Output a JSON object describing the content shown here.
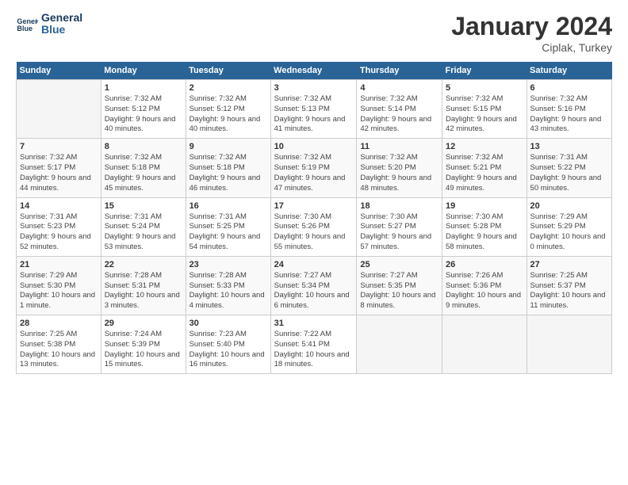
{
  "header": {
    "logo_line1": "General",
    "logo_line2": "Blue",
    "month_title": "January 2024",
    "subtitle": "Ciplak, Turkey"
  },
  "weekdays": [
    "Sunday",
    "Monday",
    "Tuesday",
    "Wednesday",
    "Thursday",
    "Friday",
    "Saturday"
  ],
  "weeks": [
    [
      {
        "day": "",
        "sunrise": "",
        "sunset": "",
        "daylight": ""
      },
      {
        "day": "1",
        "sunrise": "Sunrise: 7:32 AM",
        "sunset": "Sunset: 5:12 PM",
        "daylight": "Daylight: 9 hours and 40 minutes."
      },
      {
        "day": "2",
        "sunrise": "Sunrise: 7:32 AM",
        "sunset": "Sunset: 5:12 PM",
        "daylight": "Daylight: 9 hours and 40 minutes."
      },
      {
        "day": "3",
        "sunrise": "Sunrise: 7:32 AM",
        "sunset": "Sunset: 5:13 PM",
        "daylight": "Daylight: 9 hours and 41 minutes."
      },
      {
        "day": "4",
        "sunrise": "Sunrise: 7:32 AM",
        "sunset": "Sunset: 5:14 PM",
        "daylight": "Daylight: 9 hours and 42 minutes."
      },
      {
        "day": "5",
        "sunrise": "Sunrise: 7:32 AM",
        "sunset": "Sunset: 5:15 PM",
        "daylight": "Daylight: 9 hours and 42 minutes."
      },
      {
        "day": "6",
        "sunrise": "Sunrise: 7:32 AM",
        "sunset": "Sunset: 5:16 PM",
        "daylight": "Daylight: 9 hours and 43 minutes."
      }
    ],
    [
      {
        "day": "7",
        "sunrise": "Sunrise: 7:32 AM",
        "sunset": "Sunset: 5:17 PM",
        "daylight": "Daylight: 9 hours and 44 minutes."
      },
      {
        "day": "8",
        "sunrise": "Sunrise: 7:32 AM",
        "sunset": "Sunset: 5:18 PM",
        "daylight": "Daylight: 9 hours and 45 minutes."
      },
      {
        "day": "9",
        "sunrise": "Sunrise: 7:32 AM",
        "sunset": "Sunset: 5:18 PM",
        "daylight": "Daylight: 9 hours and 46 minutes."
      },
      {
        "day": "10",
        "sunrise": "Sunrise: 7:32 AM",
        "sunset": "Sunset: 5:19 PM",
        "daylight": "Daylight: 9 hours and 47 minutes."
      },
      {
        "day": "11",
        "sunrise": "Sunrise: 7:32 AM",
        "sunset": "Sunset: 5:20 PM",
        "daylight": "Daylight: 9 hours and 48 minutes."
      },
      {
        "day": "12",
        "sunrise": "Sunrise: 7:32 AM",
        "sunset": "Sunset: 5:21 PM",
        "daylight": "Daylight: 9 hours and 49 minutes."
      },
      {
        "day": "13",
        "sunrise": "Sunrise: 7:31 AM",
        "sunset": "Sunset: 5:22 PM",
        "daylight": "Daylight: 9 hours and 50 minutes."
      }
    ],
    [
      {
        "day": "14",
        "sunrise": "Sunrise: 7:31 AM",
        "sunset": "Sunset: 5:23 PM",
        "daylight": "Daylight: 9 hours and 52 minutes."
      },
      {
        "day": "15",
        "sunrise": "Sunrise: 7:31 AM",
        "sunset": "Sunset: 5:24 PM",
        "daylight": "Daylight: 9 hours and 53 minutes."
      },
      {
        "day": "16",
        "sunrise": "Sunrise: 7:31 AM",
        "sunset": "Sunset: 5:25 PM",
        "daylight": "Daylight: 9 hours and 54 minutes."
      },
      {
        "day": "17",
        "sunrise": "Sunrise: 7:30 AM",
        "sunset": "Sunset: 5:26 PM",
        "daylight": "Daylight: 9 hours and 55 minutes."
      },
      {
        "day": "18",
        "sunrise": "Sunrise: 7:30 AM",
        "sunset": "Sunset: 5:27 PM",
        "daylight": "Daylight: 9 hours and 57 minutes."
      },
      {
        "day": "19",
        "sunrise": "Sunrise: 7:30 AM",
        "sunset": "Sunset: 5:28 PM",
        "daylight": "Daylight: 9 hours and 58 minutes."
      },
      {
        "day": "20",
        "sunrise": "Sunrise: 7:29 AM",
        "sunset": "Sunset: 5:29 PM",
        "daylight": "Daylight: 10 hours and 0 minutes."
      }
    ],
    [
      {
        "day": "21",
        "sunrise": "Sunrise: 7:29 AM",
        "sunset": "Sunset: 5:30 PM",
        "daylight": "Daylight: 10 hours and 1 minute."
      },
      {
        "day": "22",
        "sunrise": "Sunrise: 7:28 AM",
        "sunset": "Sunset: 5:31 PM",
        "daylight": "Daylight: 10 hours and 3 minutes."
      },
      {
        "day": "23",
        "sunrise": "Sunrise: 7:28 AM",
        "sunset": "Sunset: 5:33 PM",
        "daylight": "Daylight: 10 hours and 4 minutes."
      },
      {
        "day": "24",
        "sunrise": "Sunrise: 7:27 AM",
        "sunset": "Sunset: 5:34 PM",
        "daylight": "Daylight: 10 hours and 6 minutes."
      },
      {
        "day": "25",
        "sunrise": "Sunrise: 7:27 AM",
        "sunset": "Sunset: 5:35 PM",
        "daylight": "Daylight: 10 hours and 8 minutes."
      },
      {
        "day": "26",
        "sunrise": "Sunrise: 7:26 AM",
        "sunset": "Sunset: 5:36 PM",
        "daylight": "Daylight: 10 hours and 9 minutes."
      },
      {
        "day": "27",
        "sunrise": "Sunrise: 7:25 AM",
        "sunset": "Sunset: 5:37 PM",
        "daylight": "Daylight: 10 hours and 11 minutes."
      }
    ],
    [
      {
        "day": "28",
        "sunrise": "Sunrise: 7:25 AM",
        "sunset": "Sunset: 5:38 PM",
        "daylight": "Daylight: 10 hours and 13 minutes."
      },
      {
        "day": "29",
        "sunrise": "Sunrise: 7:24 AM",
        "sunset": "Sunset: 5:39 PM",
        "daylight": "Daylight: 10 hours and 15 minutes."
      },
      {
        "day": "30",
        "sunrise": "Sunrise: 7:23 AM",
        "sunset": "Sunset: 5:40 PM",
        "daylight": "Daylight: 10 hours and 16 minutes."
      },
      {
        "day": "31",
        "sunrise": "Sunrise: 7:22 AM",
        "sunset": "Sunset: 5:41 PM",
        "daylight": "Daylight: 10 hours and 18 minutes."
      },
      {
        "day": "",
        "sunrise": "",
        "sunset": "",
        "daylight": ""
      },
      {
        "day": "",
        "sunrise": "",
        "sunset": "",
        "daylight": ""
      },
      {
        "day": "",
        "sunrise": "",
        "sunset": "",
        "daylight": ""
      }
    ]
  ]
}
